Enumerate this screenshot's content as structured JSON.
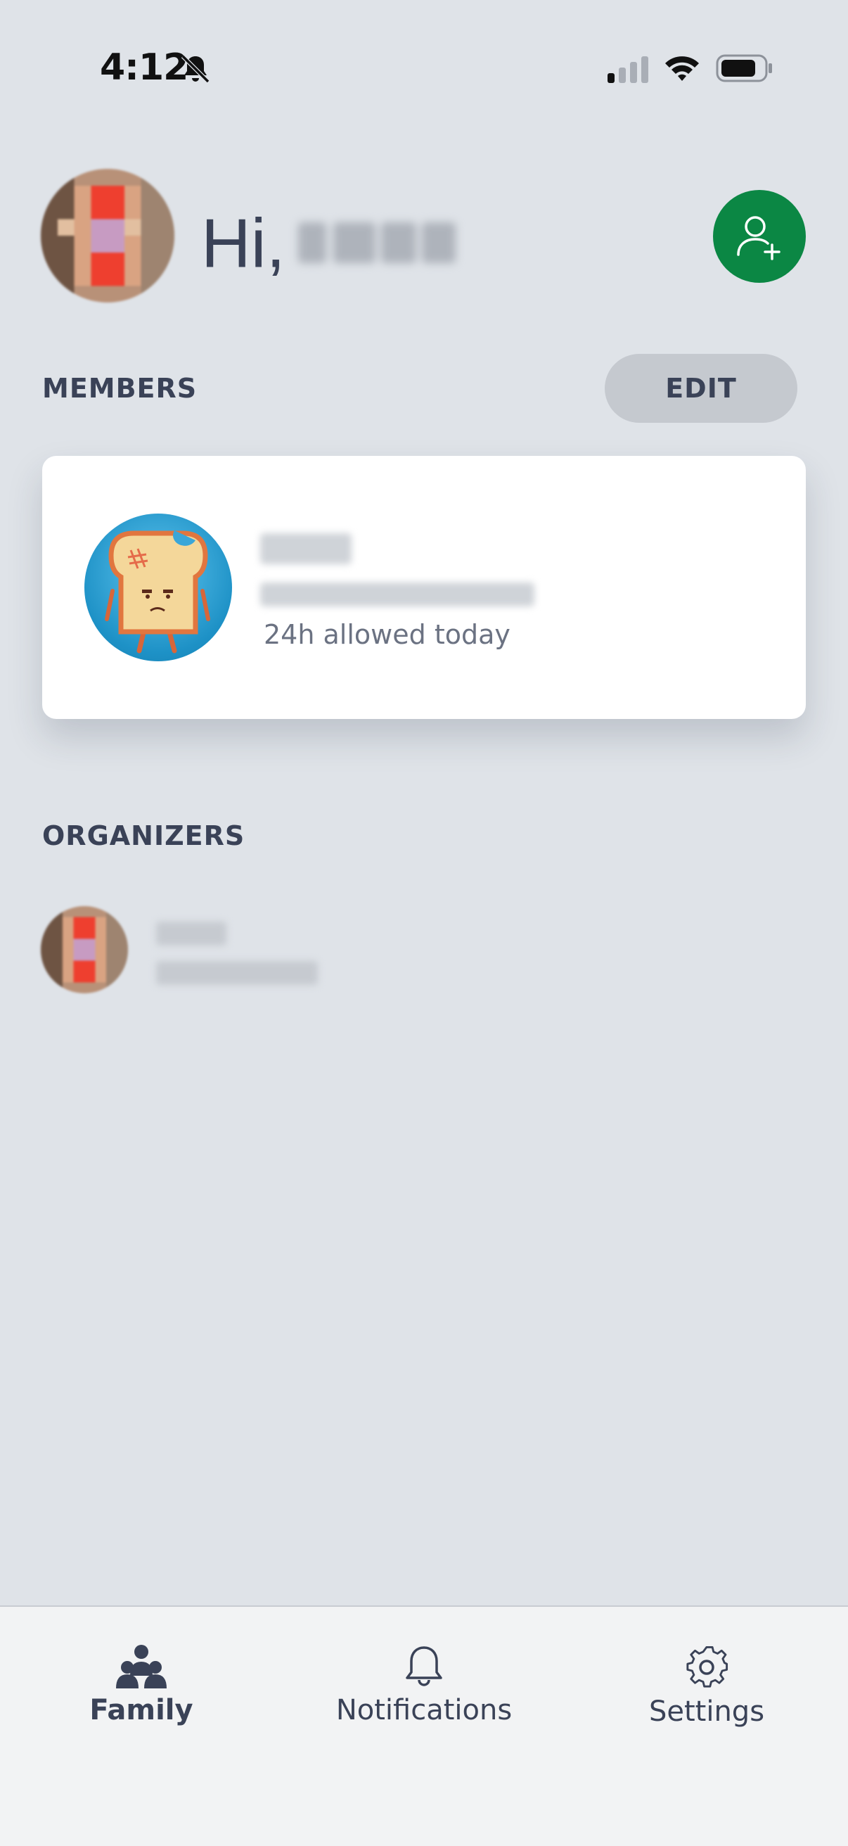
{
  "status_bar": {
    "time": "4:12",
    "silent_icon": "bell-slash-icon",
    "signal_icon": "cellular-signal-icon",
    "wifi_icon": "wifi-icon",
    "battery_icon": "battery-icon"
  },
  "header": {
    "greeting": "Hi,",
    "user_name_redacted": true,
    "add_member_icon": "add-person-icon",
    "accent_color": "#0b8744"
  },
  "members": {
    "section_label": "MEMBERS",
    "edit_label": "EDIT",
    "items": [
      {
        "avatar_icon": "toast-character-avatar",
        "name_redacted": true,
        "email_redacted": true,
        "allowance": "24h allowed today"
      }
    ]
  },
  "organizers": {
    "section_label": "ORGANIZERS",
    "items": [
      {
        "name_redacted": true,
        "email_redacted": true
      }
    ]
  },
  "tab_bar": {
    "tabs": [
      {
        "label": "Family",
        "icon": "family-icon",
        "active": true
      },
      {
        "label": "Notifications",
        "icon": "bell-icon",
        "active": false
      },
      {
        "label": "Settings",
        "icon": "gear-icon",
        "active": false
      }
    ]
  }
}
